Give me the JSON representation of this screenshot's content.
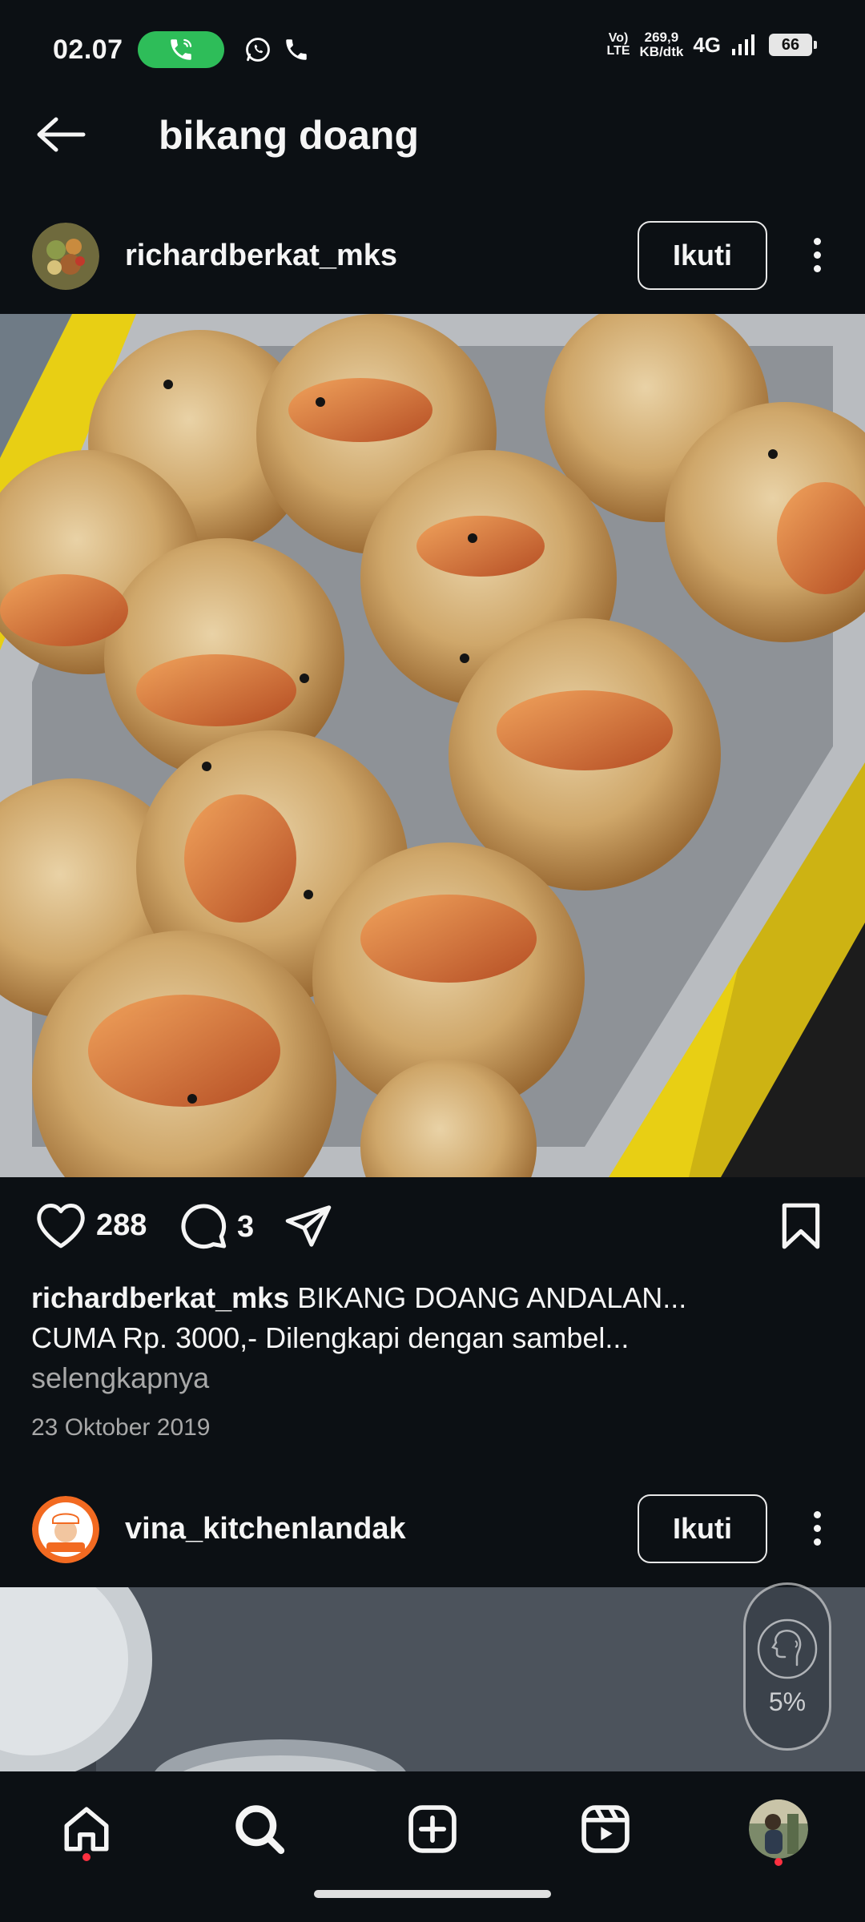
{
  "status_bar": {
    "time": "02.07",
    "volte": "Vo) LTE",
    "volte_top": "Vo)",
    "volte_bottom": "LTE",
    "speed_value": "269,9",
    "speed_unit": "KB/dtk",
    "network": "4G",
    "battery": "66"
  },
  "header": {
    "title": "bikang doang"
  },
  "post1": {
    "username": "richardberkat_mks",
    "follow_label": "Ikuti",
    "like_count": "288",
    "comment_count": "3",
    "caption_user": "richardberkat_mks",
    "caption_text_line1": "BIKANG DOANG ANDALAN...",
    "caption_text_line2": "CUMA  Rp. 3000,- Dilengkapi dengan sambel...",
    "more_label": "selengkapnya",
    "date": "23 Oktober 2019"
  },
  "post2": {
    "username": "vina_kitchenlandak",
    "follow_label": "Ikuti"
  },
  "floating_widget": {
    "percent": "5%"
  },
  "bottom_nav": {
    "items": [
      "home-icon",
      "search-icon",
      "create-icon",
      "reels-icon",
      "profile-avatar"
    ]
  },
  "colors": {
    "background": "#0c1014",
    "call_pill": "#2ebd59",
    "notification_dot": "#ff3040",
    "secondary_text": "#a8a8a8"
  }
}
